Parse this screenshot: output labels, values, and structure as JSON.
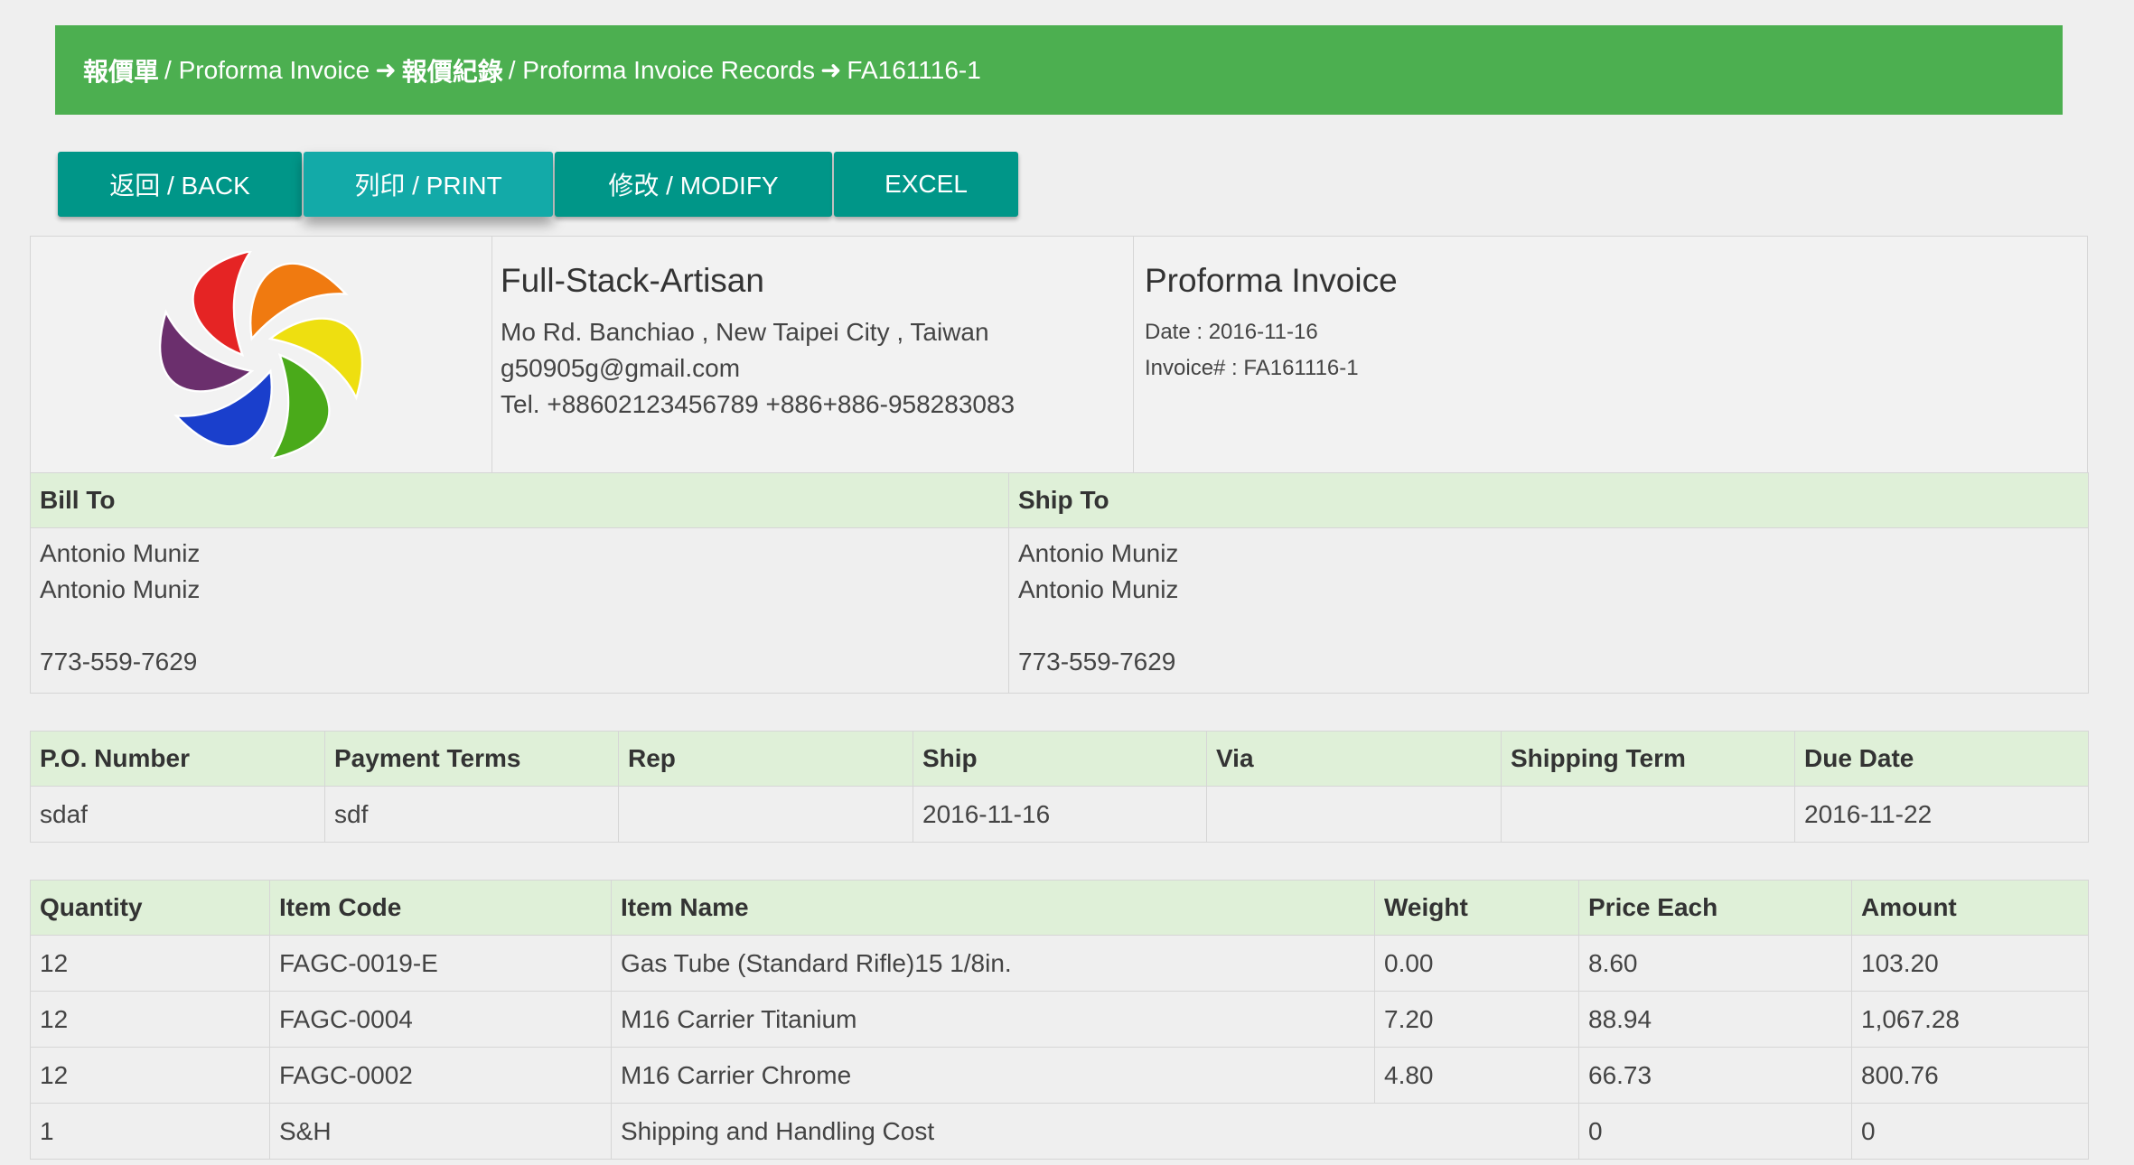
{
  "breadcrumb": {
    "part1_zh": "報價單",
    "part1_en": "/ Proforma Invoice",
    "part2_zh": "報價紀錄",
    "part2_en": "/ Proforma Invoice Records",
    "part3": "FA161116-1",
    "arrow": "➜"
  },
  "toolbar": {
    "back_label": "返回 / BACK",
    "print_label": "列印 / PRINT",
    "modify_label": "修改 / MODIFY",
    "excel_label": "EXCEL"
  },
  "company": {
    "name": "Full-Stack-Artisan",
    "address": "Mo Rd. Banchiao , New Taipei City , Taiwan",
    "email": "g50905g@gmail.com",
    "tel": "Tel. +88602123456789 +886+886-958283083"
  },
  "invoice": {
    "title": "Proforma Invoice",
    "date": "Date : 2016-11-16",
    "number": "Invoice# : FA161116-1"
  },
  "bill_to": {
    "header": "Bill To",
    "line1": "Antonio Muniz",
    "line2": "Antonio Muniz",
    "phone": "773-559-7629"
  },
  "ship_to": {
    "header": "Ship To",
    "line1": "Antonio Muniz",
    "line2": "Antonio Muniz",
    "phone": "773-559-7629"
  },
  "order_info": {
    "headers": [
      "P.O. Number",
      "Payment Terms",
      "Rep",
      "Ship",
      "Via",
      "Shipping Term",
      "Due Date"
    ],
    "values": [
      "sdaf",
      "sdf",
      "",
      "2016-11-16",
      "",
      "",
      "2016-11-22"
    ]
  },
  "items": {
    "headers": [
      "Quantity",
      "Item Code",
      "Item Name",
      "Weight",
      "Price Each",
      "Amount"
    ],
    "rows": [
      [
        "12",
        "FAGC-0019-E",
        "Gas Tube (Standard Rifle)15 1/8in.",
        "0.00",
        "8.60",
        "103.20"
      ],
      [
        "12",
        "FAGC-0004",
        "M16 Carrier Titanium",
        "7.20",
        "88.94",
        "1,067.28"
      ],
      [
        "12",
        "FAGC-0002",
        "M16 Carrier Chrome",
        "4.80",
        "66.73",
        "800.76"
      ],
      [
        "1",
        "S&H",
        "Shipping and Handling Cost",
        "",
        "0",
        "0"
      ]
    ]
  },
  "colors": {
    "header_green": "#4caf50",
    "button_teal": "#009688",
    "table_header": "#dff0d8"
  },
  "logo": {
    "icon": "rainbow-swirl-logo",
    "petal_colors": [
      "#f07a10",
      "#eedf10",
      "#4aaa1a",
      "#1a3fcc",
      "#6b2f6d",
      "#e52424"
    ]
  }
}
